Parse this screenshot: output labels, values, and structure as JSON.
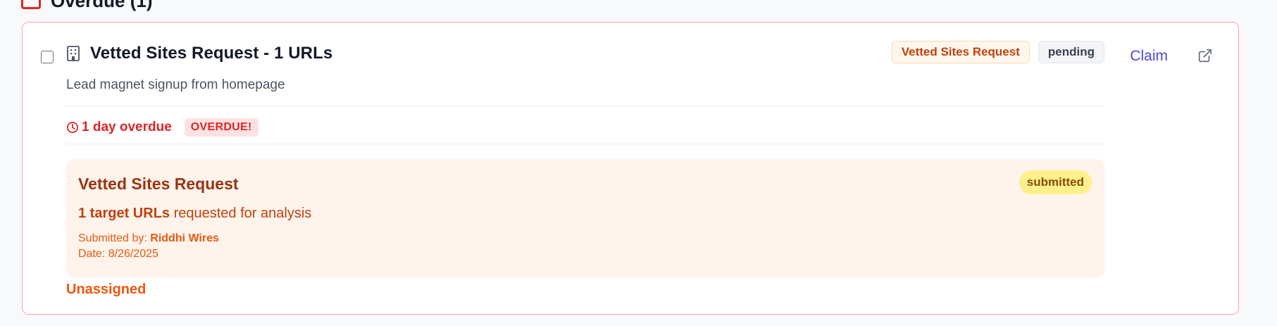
{
  "section": {
    "title": "Overdue (1)"
  },
  "task": {
    "title": "Vetted Sites Request - 1 URLs",
    "subtitle": "Lead magnet signup from homepage",
    "type_badge": "Vetted Sites Request",
    "status_badge": "pending",
    "claim_label": "Claim",
    "overdue_text": "1 day overdue",
    "overdue_flag": "OVERDUE!",
    "assignee": "Unassigned"
  },
  "request": {
    "title": "Vetted Sites Request",
    "status": "submitted",
    "target_count": "1 target URLs",
    "target_suffix": "requested for analysis",
    "submitted_by_label": "Submitted by:",
    "submitted_by": "Riddhi Wires",
    "date_label": "Date:",
    "date": "8/26/2025"
  },
  "colors": {
    "accent": "#4f46e5",
    "overdue": "#dc2626",
    "request_bg": "#fff4ec",
    "card_border": "#fca5a5"
  },
  "icons": [
    "alert-icon",
    "building-icon",
    "clock-icon",
    "external-link-icon"
  ]
}
